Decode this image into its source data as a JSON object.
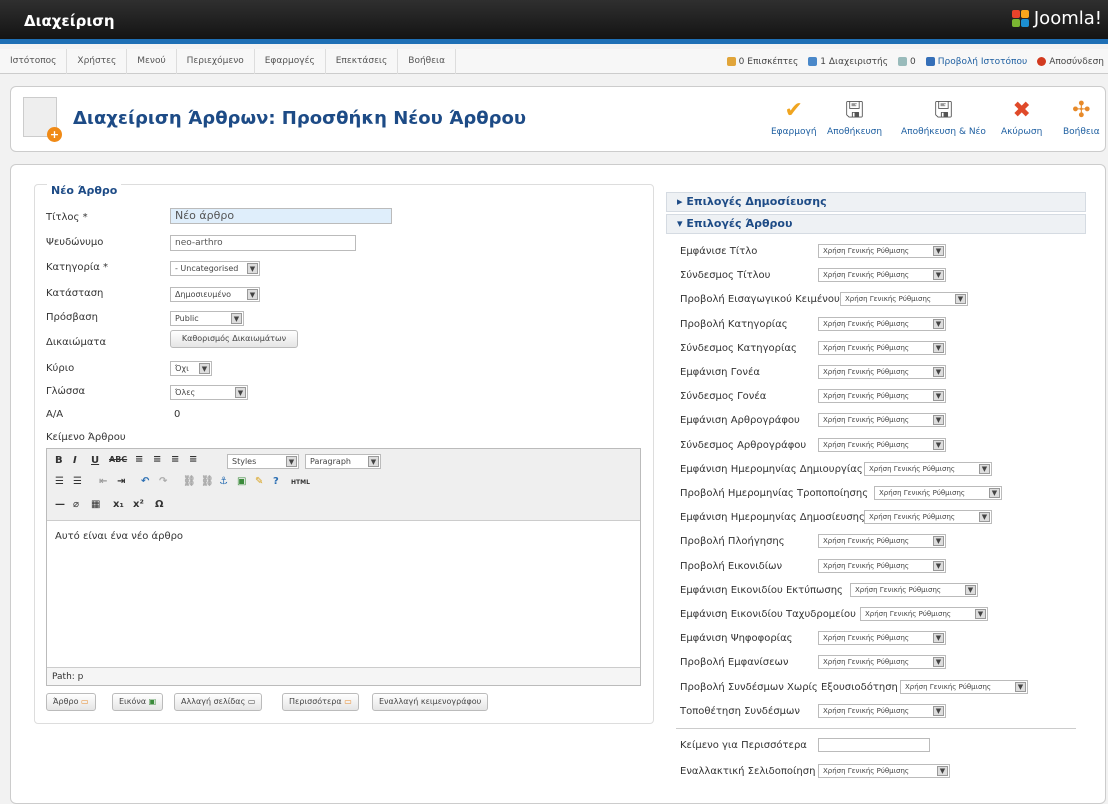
{
  "header": {
    "title": "Διαχείριση",
    "brand": "Joomla!"
  },
  "menu": [
    "Ιστότοπος",
    "Χρήστες",
    "Μενού",
    "Περιεχόμενο",
    "Εφαρμογές",
    "Επεκτάσεις",
    "Βοήθεια"
  ],
  "status": {
    "visitors": "0 Επισκέπτες",
    "admins": "1 Διαχειριστής",
    "messages": "0",
    "view_site": "Προβολή Ιστοτόπου",
    "logout": "Αποσύνδεση"
  },
  "page": {
    "title": "Διαχείριση Άρθρων: Προσθήκη Νέου Άρθρου"
  },
  "toolbar": {
    "apply": "Εφαρμογή",
    "save": "Αποθήκευση",
    "save_new": "Αποθήκευση & Νέο",
    "cancel": "Ακύρωση",
    "help": "Βοήθεια"
  },
  "form": {
    "legend": "Νέο Άρθρο",
    "title_label": "Τίτλος *",
    "title_value": "Νέο άρθρο",
    "alias_label": "Ψευδώνυμο",
    "alias_value": "neo-arthro",
    "category_label": "Κατηγορία *",
    "category_value": "- Uncategorised",
    "state_label": "Κατάσταση",
    "state_value": "Δημοσιευμένο",
    "access_label": "Πρόσβαση",
    "access_value": "Public",
    "permissions_label": "Δικαιώματα",
    "permissions_button": "Καθορισμός Δικαιωμάτων",
    "featured_label": "Κύριο",
    "featured_value": "Όχι",
    "language_label": "Γλώσσα",
    "language_value": "Όλες",
    "id_label": "Α/Α",
    "id_value": "0",
    "text_label": "Κείμενο Άρθρου"
  },
  "editor": {
    "styles": "Styles",
    "paragraph": "Paragraph",
    "content": "Αυτό είναι ένα νέο άρθρο",
    "path": "Path: p"
  },
  "bottom_buttons": [
    "Άρθρο",
    "Εικόνα",
    "Αλλαγή σελίδας",
    "Περισσότερα",
    "Εναλλαγή κειμενογράφου"
  ],
  "right": {
    "publishing": "▸ Επιλογές Δημοσίευσης",
    "article_options": "▾ Επιλογές Άρθρου",
    "global": "Χρήση Γενικής Ρύθμισης",
    "options": [
      "Εμφάνισε Τίτλο",
      "Σύνδεσμος Τίτλου",
      "Προβολή Εισαγωγικού Κειμένου",
      "Προβολή Κατηγορίας",
      "Σύνδεσμος Κατηγορίας",
      "Εμφάνιση Γονέα",
      "Σύνδεσμος Γονέα",
      "Εμφάνιση Αρθρογράφου",
      "Σύνδεσμος Αρθρογράφου",
      "Εμφάνιση Ημερομηνίας Δημιουργίας",
      "Προβολή Ημερομηνίας Τροποποίησης",
      "Εμφάνιση Ημερομηνίας Δημοσίευσης",
      "Προβολή Πλοήγησης",
      "Προβολή Εικονιδίων",
      "Εμφάνιση Εικονιδίου Εκτύπωσης",
      "Εμφάνιση Εικονιδίου Ταχυδρομείου",
      "Εμφάνιση Ψηφοφορίας",
      "Προβολή Εμφανίσεων",
      "Προβολή Συνδέσμων Χωρίς Εξουσιοδότηση",
      "Τοποθέτηση Συνδέσμων"
    ],
    "readmore_label": "Κείμενο για Περισσότερα",
    "alt_layout_label": "Εναλλακτική Σελιδοποίηση"
  }
}
